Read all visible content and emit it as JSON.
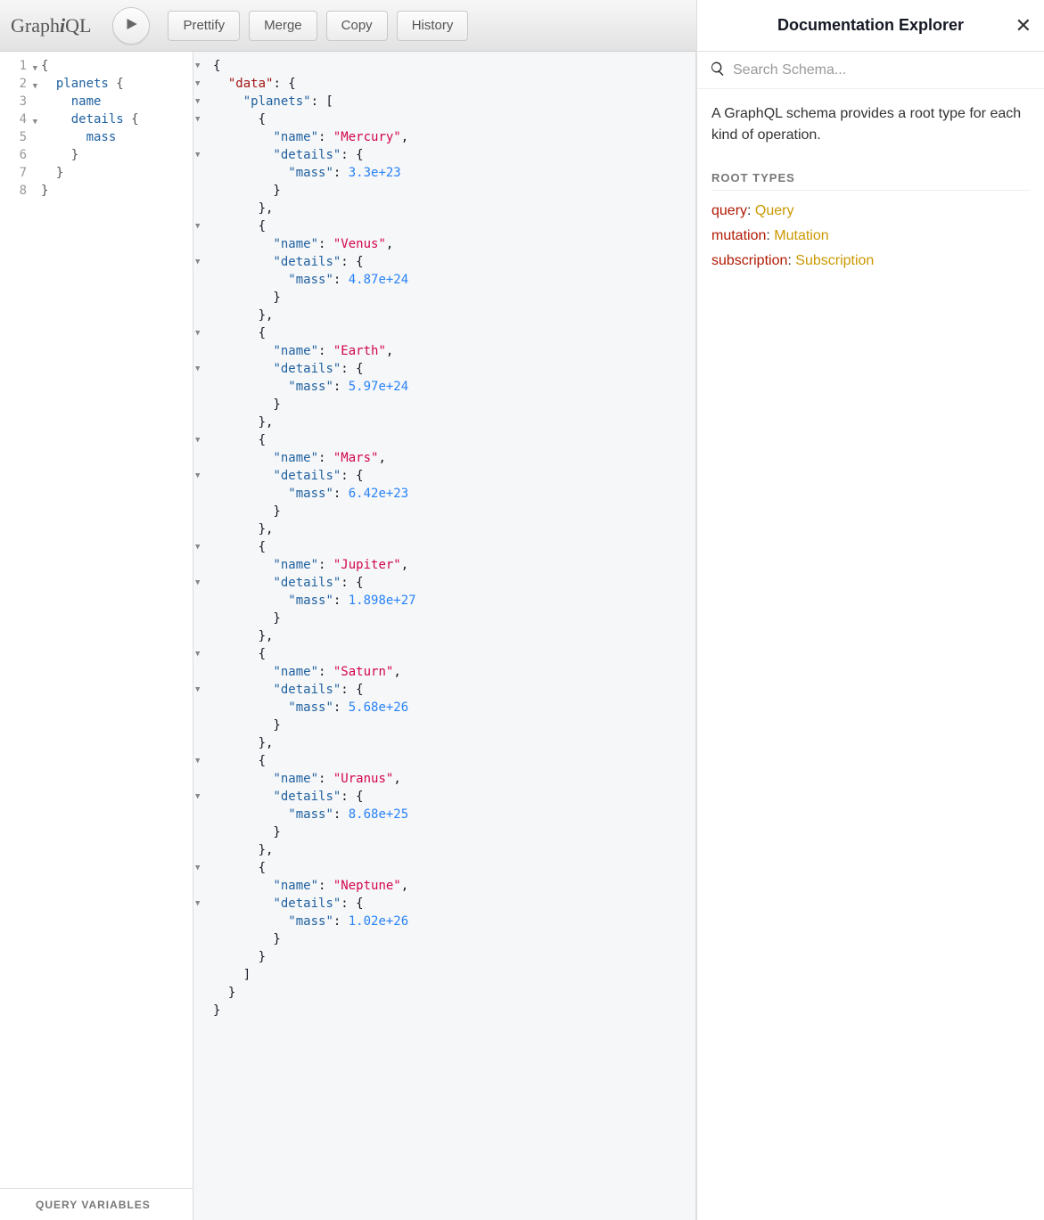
{
  "logo_html": "Graph<i>i</i>QL",
  "toolbar": {
    "prettify": "Prettify",
    "merge": "Merge",
    "copy": "Copy",
    "history": "History"
  },
  "query": {
    "lines": [
      "{",
      "  planets {",
      "    name",
      "    details {",
      "      mass",
      "    }",
      "  }",
      "}"
    ],
    "fold_lines": [
      1,
      2,
      4
    ]
  },
  "query_vars_label": "QUERY VARIABLES",
  "result": {
    "data": {
      "planets": [
        {
          "name": "Mercury",
          "details": {
            "mass": "3.3e+23"
          }
        },
        {
          "name": "Venus",
          "details": {
            "mass": "4.87e+24"
          }
        },
        {
          "name": "Earth",
          "details": {
            "mass": "5.97e+24"
          }
        },
        {
          "name": "Mars",
          "details": {
            "mass": "6.42e+23"
          }
        },
        {
          "name": "Jupiter",
          "details": {
            "mass": "1.898e+27"
          }
        },
        {
          "name": "Saturn",
          "details": {
            "mass": "5.68e+26"
          }
        },
        {
          "name": "Uranus",
          "details": {
            "mass": "8.68e+25"
          }
        },
        {
          "name": "Neptune",
          "details": {
            "mass": "1.02e+26"
          }
        }
      ]
    }
  },
  "doc": {
    "title": "Documentation Explorer",
    "search_placeholder": "Search Schema...",
    "description": "A GraphQL schema provides a root type for each kind of operation.",
    "root_types_label": "ROOT TYPES",
    "root_types": [
      {
        "key": "query",
        "type": "Query"
      },
      {
        "key": "mutation",
        "type": "Mutation"
      },
      {
        "key": "subscription",
        "type": "Subscription"
      }
    ]
  }
}
